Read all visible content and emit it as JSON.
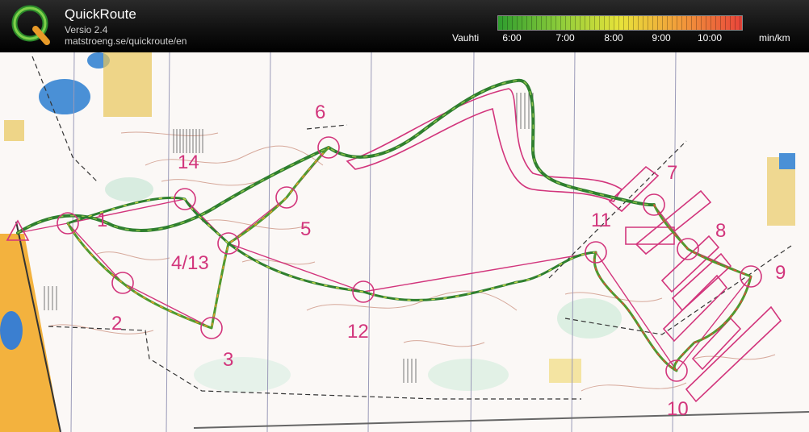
{
  "app": {
    "title": "QuickRoute",
    "version": "Versio 2.4",
    "url": "matstroeng.se/quickroute/en"
  },
  "pace_legend": {
    "label": "Vauhti",
    "ticks": [
      "6:00",
      "7:00",
      "8:00",
      "9:00",
      "10:00"
    ],
    "unit": "min/km",
    "colors": [
      "#2e9d2e",
      "#8ccc3a",
      "#e8e33a",
      "#f29a3a",
      "#e8443a"
    ]
  },
  "map": {
    "control_color": "#d2357c",
    "route_color": "#2f7f2f",
    "controls": [
      {
        "label": "1"
      },
      {
        "label": "2"
      },
      {
        "label": "3"
      },
      {
        "label": "4/13"
      },
      {
        "label": "5"
      },
      {
        "label": "6"
      },
      {
        "label": "7"
      },
      {
        "label": "8"
      },
      {
        "label": "9"
      },
      {
        "label": "10"
      },
      {
        "label": "11"
      },
      {
        "label": "12"
      },
      {
        "label": "14"
      }
    ]
  }
}
